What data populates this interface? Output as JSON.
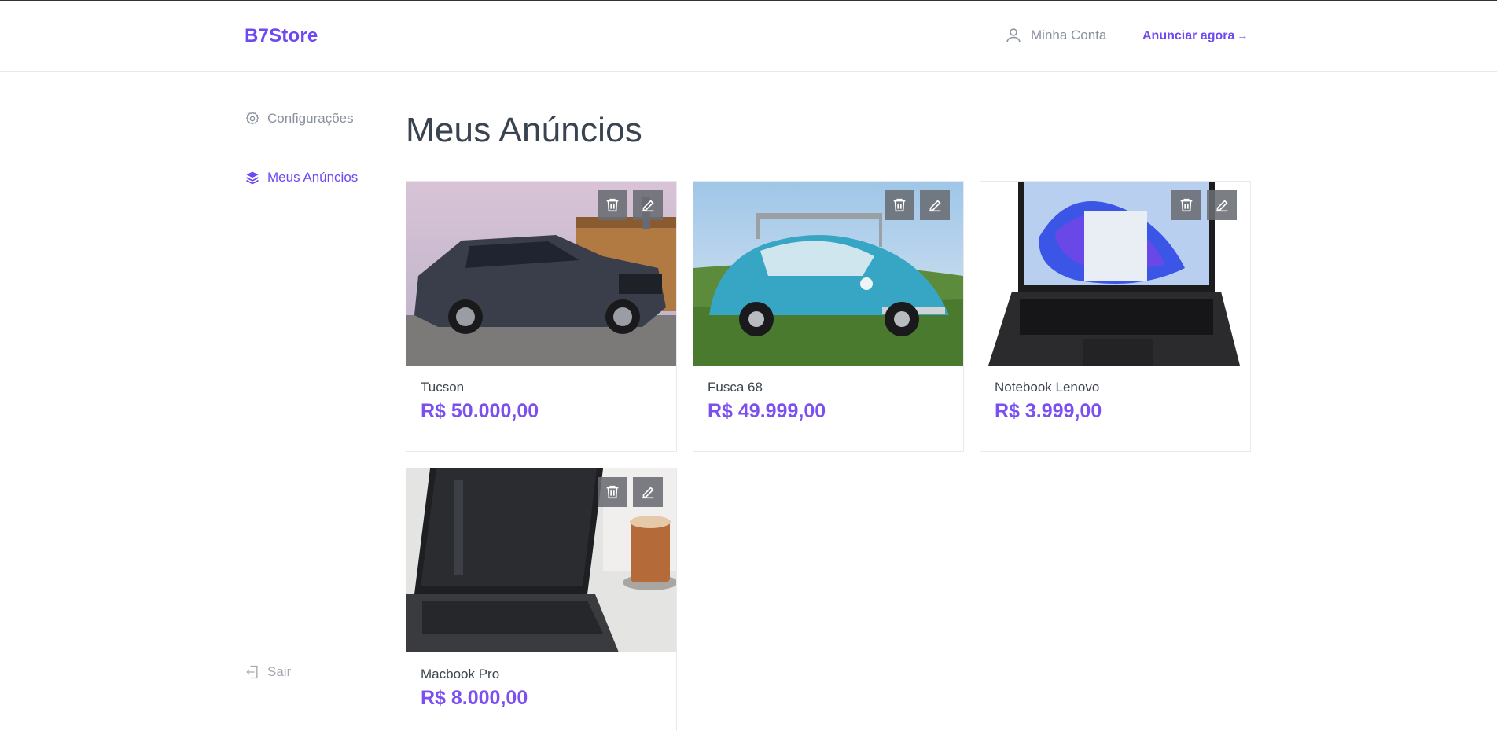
{
  "header": {
    "logo": "B7Store",
    "account_label": "Minha Conta",
    "advertise_label": "Anunciar agora",
    "advertise_arrow": "→"
  },
  "sidebar": {
    "items": [
      {
        "label": "Configurações",
        "icon": "gear-icon"
      },
      {
        "label": "Meus Anúncios",
        "icon": "layers-icon",
        "active": true
      },
      {
        "label": "Sair",
        "icon": "logout-icon"
      }
    ]
  },
  "main": {
    "title": "Meus Anúncios",
    "ads": [
      {
        "name": "Tucson",
        "price": "R$ 50.000,00",
        "image": "dark gray SUV photo"
      },
      {
        "name": "Fusca 68",
        "price": "R$ 49.999,00",
        "image": "blue beetle car on grass photo"
      },
      {
        "name": "Notebook Lenovo",
        "price": "R$ 3.999,00",
        "image": "black laptop with blue wallpaper photo"
      },
      {
        "name": "Macbook Pro",
        "price": "R$ 8.000,00",
        "image": "laptop with coffee cup photo"
      }
    ]
  },
  "colors": {
    "accent": "#6e49f2",
    "price": "#7b4ff0",
    "muted": "#8a919c",
    "border": "#e8e9ec"
  }
}
